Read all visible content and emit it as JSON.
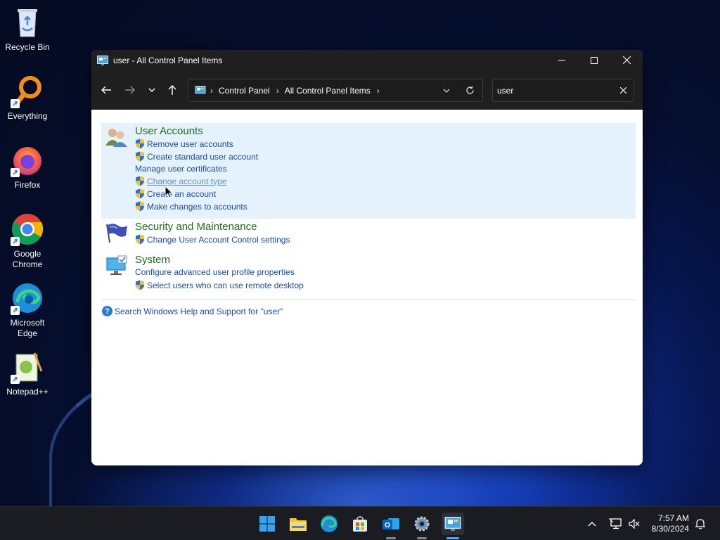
{
  "desktop": {
    "icons": [
      {
        "label": "Recycle Bin"
      },
      {
        "label": "Everything"
      },
      {
        "label": "Firefox"
      },
      {
        "label": "Google Chrome"
      },
      {
        "label": "Microsoft Edge"
      },
      {
        "label": "Notepad++"
      }
    ]
  },
  "window": {
    "title": "user - All Control Panel Items",
    "address": {
      "crumbs": [
        "Control Panel",
        "All Control Panel Items"
      ]
    },
    "search": {
      "value": "user"
    },
    "groups": [
      {
        "title": "User Accounts",
        "tasks": [
          {
            "label": "Remove user accounts",
            "shield": true
          },
          {
            "label": "Create standard user account",
            "shield": true
          },
          {
            "label": "Manage user certificates",
            "shield": false
          },
          {
            "label": "Change account type",
            "shield": true
          },
          {
            "label": "Create an account",
            "shield": true
          },
          {
            "label": "Make changes to accounts",
            "shield": true
          }
        ]
      },
      {
        "title": "Security and Maintenance",
        "tasks": [
          {
            "label": "Change User Account Control settings",
            "shield": true
          }
        ]
      },
      {
        "title": "System",
        "tasks": [
          {
            "label": "Configure advanced user profile properties",
            "shield": false
          },
          {
            "label": "Select users who can use remote desktop",
            "shield": true
          }
        ]
      }
    ],
    "help_link": "Search Windows Help and Support for \"user\""
  },
  "taskbar": {
    "apps": [
      "start-icon",
      "file-explorer-icon",
      "edge-icon",
      "store-icon",
      "outlook-icon",
      "settings-icon",
      "control-panel-icon"
    ],
    "clock": {
      "time": "7:57 AM",
      "date": "8/30/2024"
    }
  },
  "colors": {
    "group_title": "#1e6b1e",
    "link": "#1a4fa0",
    "hover_link": "#5b95d6",
    "highlight": "#e5f1fb",
    "titlebar": "#1f1f1f"
  }
}
